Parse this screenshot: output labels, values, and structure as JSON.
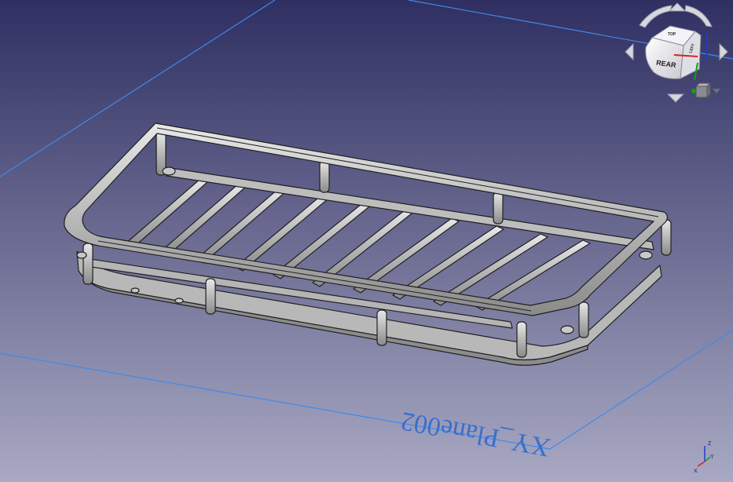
{
  "viewport": {
    "background_top": "#2f2f62",
    "background_bottom": "#a9a9c4"
  },
  "plane": {
    "label": "XY_Plane002",
    "color": "#3d8bec"
  },
  "model": {
    "name": "rack",
    "body_color": "#c6c6c6",
    "edge_color": "#202020"
  },
  "navigation_cube": {
    "faces": {
      "front": "REAR",
      "top": "TOP",
      "right": "LEFT"
    },
    "menu_icon": "cube-menu-icon"
  },
  "axis_triad": {
    "x": "X",
    "y": "Y",
    "z": "Z",
    "colors": {
      "x": "#e02020",
      "y": "#10a010",
      "z": "#1a3cd0"
    }
  }
}
